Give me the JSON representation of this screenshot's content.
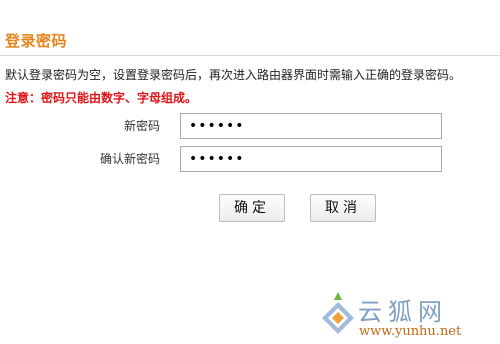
{
  "section": {
    "title": "登录密码"
  },
  "description": "默认登录密码为空，设置登录密码后，再次进入路由器界面时需输入正确的登录密码。",
  "note": "注意：密码只能由数字、字母组成。",
  "form": {
    "new_password_label": "新密码",
    "new_password_value": "••••••",
    "confirm_password_label": "确认新密码",
    "confirm_password_value": "••••••"
  },
  "buttons": {
    "confirm": "确定",
    "cancel": "取消"
  },
  "watermark": {
    "site_name": "云狐网",
    "url": "www.yunhu.net",
    "logo_icon": "yunhu-logo-icon"
  },
  "colors": {
    "title": "#e8851c",
    "note": "#e0151a",
    "watermark_text": "#7fa0c4",
    "watermark_url": "#c06a14"
  }
}
